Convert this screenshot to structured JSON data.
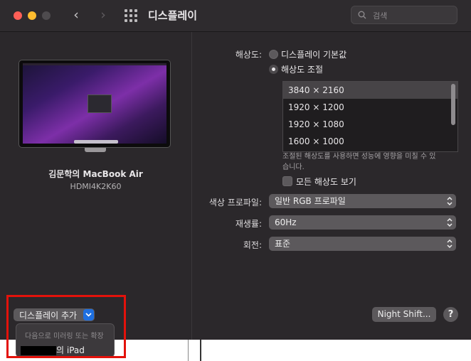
{
  "window": {
    "title": "디스플레이"
  },
  "search": {
    "placeholder": "검색"
  },
  "display": {
    "name": "김문학의 MacBook Air",
    "model": "HDMI4K2K60"
  },
  "resolution": {
    "label": "해상도:",
    "option_default": "디스플레이 기본값",
    "option_scaled": "해상도 조절",
    "selected_option": "해상도 조절",
    "list": [
      "3840 × 2160",
      "1920 × 1200",
      "1920 × 1080",
      "1600 × 1000"
    ],
    "selected": "3840 × 2160",
    "note": "조절된 해상도를 사용하면 성능에 영향을 미칠 수 있습니다.",
    "show_all_label": "모든 해상도 보기",
    "show_all_checked": false
  },
  "color_profile": {
    "label": "색상 프로파일:",
    "value": "일반 RGB 프로파일"
  },
  "refresh_rate": {
    "label": "재생률:",
    "value": "60Hz"
  },
  "rotation": {
    "label": "회전:",
    "value": "표준"
  },
  "add_display": {
    "label": "디스플레이 추가",
    "menu_header": "다음으로 미러링 또는 확장",
    "menu_item_suffix": "의 iPad"
  },
  "night_shift_label": "Night Shift...",
  "help_label": "?",
  "colors": {
    "accent": "#1e6fe0",
    "highlight": "#e3120b",
    "window_bg": "#2b282b"
  }
}
